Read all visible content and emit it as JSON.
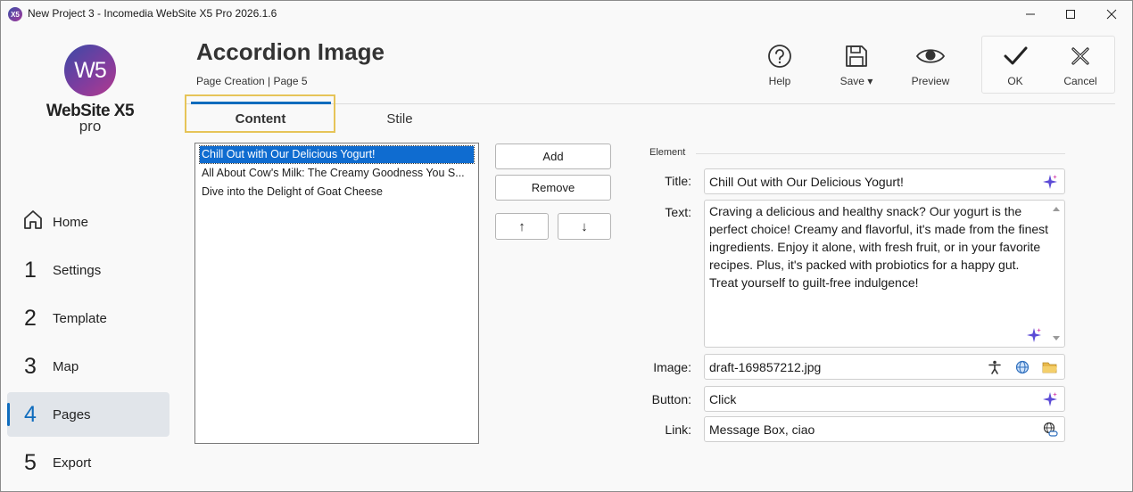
{
  "window": {
    "title": "New Project 3 - Incomedia WebSite X5 Pro 2026.1.6",
    "app_icon_text": "X5"
  },
  "logo": {
    "mark": "W5",
    "name": "WebSite X5",
    "edition": "pro"
  },
  "nav": [
    {
      "num": "",
      "label": "Home",
      "icon": "home-icon"
    },
    {
      "num": "1",
      "label": "Settings"
    },
    {
      "num": "2",
      "label": "Template"
    },
    {
      "num": "3",
      "label": "Map"
    },
    {
      "num": "4",
      "label": "Pages",
      "active": true
    },
    {
      "num": "5",
      "label": "Export"
    }
  ],
  "header": {
    "title": "Accordion Image",
    "breadcrumb": "Page Creation | Page 5"
  },
  "toolbar": {
    "help": "Help",
    "save": "Save",
    "save_arrow": "▾",
    "preview": "Preview",
    "ok": "OK",
    "cancel": "Cancel"
  },
  "tabs": {
    "content": "Content",
    "style": "Stile",
    "active": "Content"
  },
  "list": {
    "items": [
      "Chill Out with Our Delicious Yogurt!",
      "All About Cow's Milk: The Creamy Goodness You S...",
      "Dive into the Delight of Goat Cheese"
    ],
    "selected_index": 0
  },
  "list_buttons": {
    "add": "Add",
    "remove": "Remove",
    "up": "↑",
    "down": "↓"
  },
  "element": {
    "section": "Element",
    "title_label": "Title:",
    "title_value": "Chill Out with Our Delicious Yogurt!",
    "text_label": "Text:",
    "text_value": "Craving a delicious and healthy snack? Our yogurt is the perfect choice! Creamy and flavorful, it's made from the finest ingredients. Enjoy it alone, with fresh fruit, or in your favorite recipes. Plus, it's packed with probiotics for a happy gut. Treat yourself to guilt-free indulgence!",
    "image_label": "Image:",
    "image_value": "draft-169857212.jpg",
    "button_label": "Button:",
    "button_value": "Click",
    "link_label": "Link:",
    "link_value": "Message Box, ciao"
  },
  "colors": {
    "accent": "#0f6cbd",
    "tab_highlight": "#e6c458",
    "selection": "#0f6cd0"
  }
}
